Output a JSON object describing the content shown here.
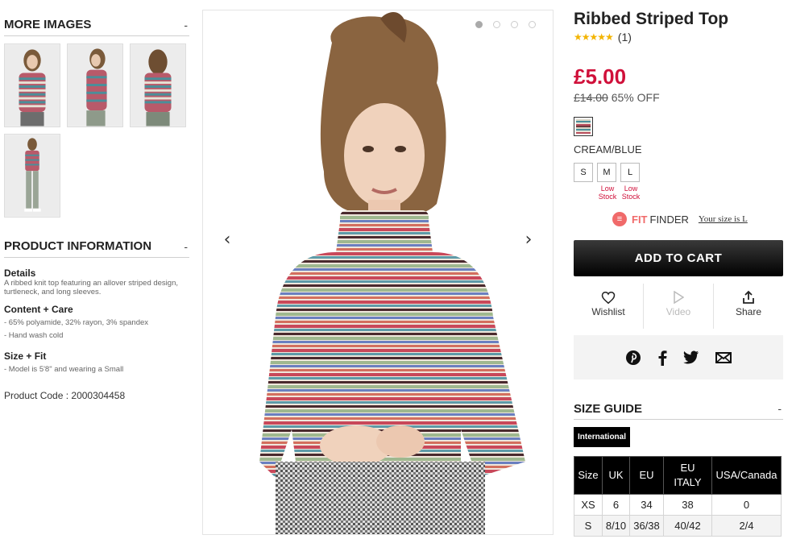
{
  "more_images": {
    "title": "MORE IMAGES",
    "toggle": "-"
  },
  "product_info": {
    "title": "PRODUCT INFORMATION",
    "toggle": "-",
    "details_label": "Details",
    "details_text": "A ribbed knit top featuring an allover striped design, turtleneck, and long sleeves.",
    "content_label": "Content + Care",
    "content_lines": [
      "- 65% polyamide, 32% rayon, 3% spandex",
      "- Hand wash cold"
    ],
    "fit_label": "Size + Fit",
    "fit_lines": [
      "- Model is 5'8\" and wearing a Small"
    ],
    "code_label": "Product Code : ",
    "code_value": "2000304458"
  },
  "gallery": {
    "dots": 4,
    "active_dot": 0,
    "prev_icon": "chevron-left-icon",
    "next_icon": "chevron-right-icon"
  },
  "product": {
    "title": "Ribbed Striped Top",
    "stars": "★★★★★",
    "rating_count": "(1)",
    "price": "£5.00",
    "was_price": "£14.00",
    "discount": "65% OFF",
    "color_name": "CREAM/BLUE",
    "sizes": [
      "S",
      "M",
      "L"
    ],
    "low_stock": [
      "Low Stock",
      "Low Stock"
    ]
  },
  "fit_finder": {
    "icon_letter": "≡",
    "fit": "FIT",
    "finder": "FINDER",
    "link": "Your size is L"
  },
  "cart": {
    "label": "ADD TO CART"
  },
  "actions": {
    "wishlist": "Wishlist",
    "video": "Video",
    "share": "Share"
  },
  "share_icons": [
    "pinterest-icon",
    "facebook-icon",
    "twitter-icon",
    "email-icon"
  ],
  "size_guide": {
    "title": "SIZE GUIDE",
    "toggle": "-",
    "tab": "International",
    "headers": [
      "Size",
      "UK",
      "EU",
      "EU ITALY",
      "USA/Canada"
    ],
    "rows": [
      [
        "XS",
        "6",
        "34",
        "38",
        "0"
      ],
      [
        "S",
        "8/10",
        "36/38",
        "40/42",
        "2/4"
      ]
    ]
  },
  "colors": {
    "price_red": "#d0103a",
    "star": "#f3b400",
    "fitfinder": "#f06a6a"
  }
}
